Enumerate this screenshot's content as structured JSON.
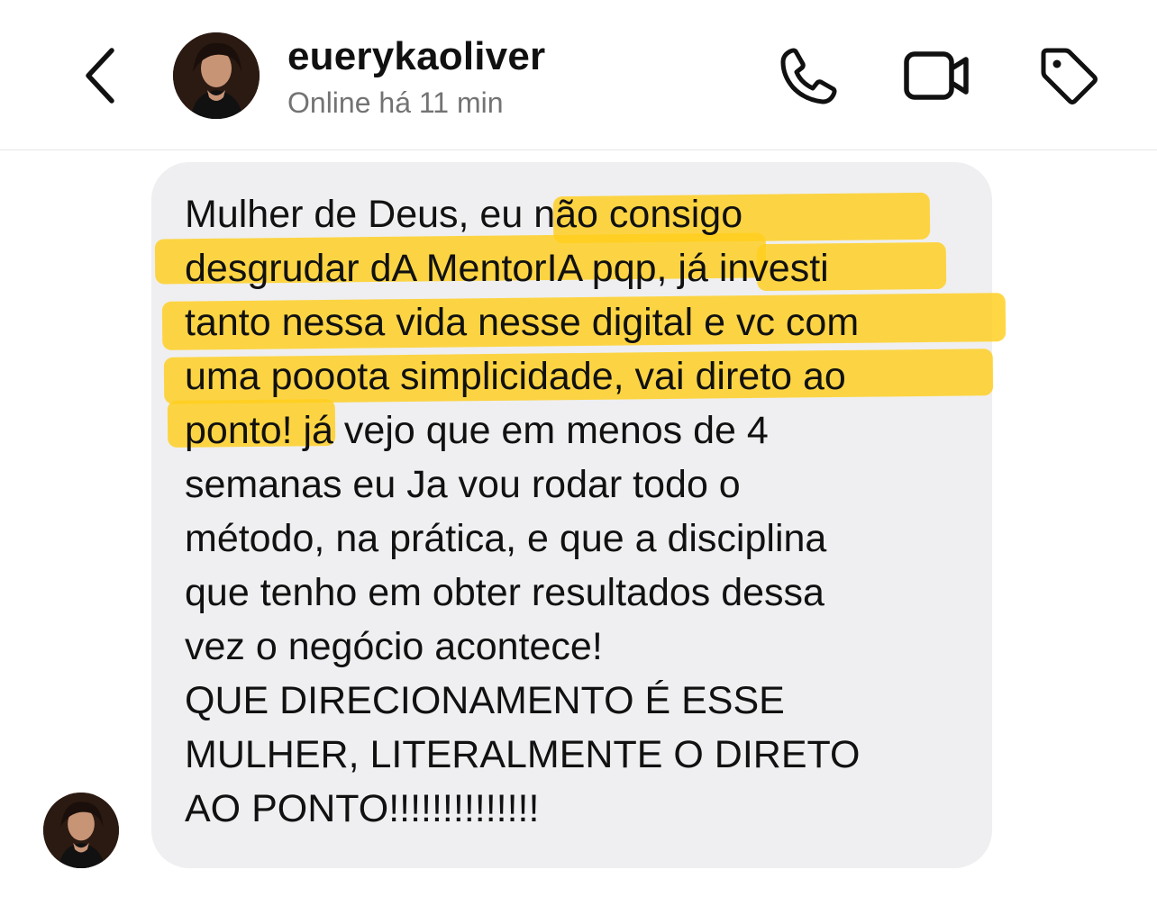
{
  "header": {
    "back_icon": "chevron-left-icon",
    "contact_name": "euerykaoliver",
    "status": "Online há 11 min",
    "actions": [
      {
        "name": "call",
        "icon": "phone-icon"
      },
      {
        "name": "video",
        "icon": "video-camera-icon"
      },
      {
        "name": "tag",
        "icon": "tag-icon"
      }
    ]
  },
  "message": {
    "lines": [
      "Mulher de Deus, eu não consigo",
      "desgrudar dA MentorIA pqp, já investi",
      "tanto nessa vida nesse digital e vc com",
      "uma pooota simplicidade, vai direto ao",
      "ponto! já vejo que em menos de 4",
      "semanas eu Ja vou rodar todo o",
      "método, na prática, e que a disciplina",
      "que tenho em obter resultados dessa",
      "vez o negócio acontece!",
      "QUE DIRECIONAMENTO É ESSE",
      "MULHER, LITERALMENTE O DIRETO",
      "AO PONTO!!!!!!!!!!!!!!"
    ],
    "highlight_color": "#FFCE1C",
    "bubble_color": "#EFEFF1"
  },
  "colors": {
    "text": "#111111",
    "secondary_text": "#737373",
    "background": "#FFFFFF"
  }
}
